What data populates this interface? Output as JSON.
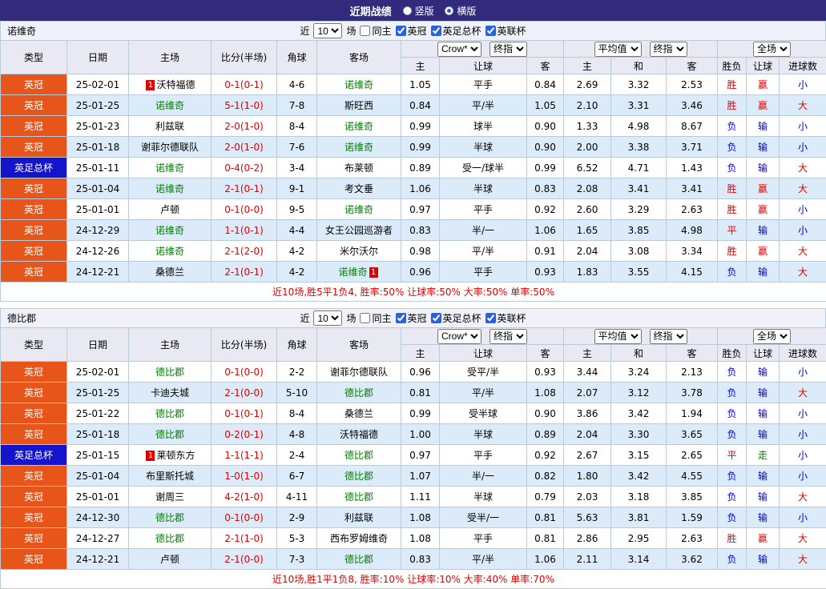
{
  "topbar": {
    "title": "近期战绩",
    "radios": [
      {
        "label": "竖版",
        "selected": false
      },
      {
        "label": "横版",
        "selected": true
      }
    ]
  },
  "colors": {
    "topbar_bg": "#322b7d",
    "league_bg": "#e8551a",
    "cup_bg": "#1414cc",
    "row_alt_bg": "#dcebf9",
    "grid_line": "#b9cadd",
    "header_bg": "#e9e9f3",
    "win_red": "#e00000",
    "lose_blue": "#0000d0",
    "team_green": "#008000"
  },
  "table_header": {
    "cols": [
      "类型",
      "日期",
      "主场",
      "比分(半场)",
      "角球",
      "客场"
    ],
    "bookmaker_select": "Crow*",
    "stage_select_1": "终指",
    "average_select": "平均值",
    "stage_select_2": "终指",
    "scope_select": "全场",
    "sub_cols": [
      "主",
      "让球",
      "客",
      "主",
      "和",
      "客",
      "胜负",
      "让球",
      "进球数"
    ]
  },
  "sections": [
    {
      "team": "诺维奇",
      "controls": {
        "near_label": "近",
        "games_count": "10",
        "games_suffix": "场",
        "same_home": {
          "label": "同主",
          "checked": false
        },
        "league_filters": [
          {
            "label": "英冠",
            "checked": true
          },
          {
            "label": "英足总杯",
            "checked": true
          },
          {
            "label": "英联杯",
            "checked": true
          }
        ]
      },
      "rows": [
        {
          "league": "英冠",
          "league_style": "league",
          "date": "25-02-01",
          "home": {
            "name": "沃特福德",
            "self": false,
            "red_card": "1",
            "card_pos": "left"
          },
          "score": "0-1(0-1)",
          "corners": "4-6",
          "away": {
            "name": "诺维奇",
            "self": true
          },
          "odds": {
            "home": "1.05",
            "handicap": "平手",
            "away": "0.84"
          },
          "avg": {
            "home": "2.69",
            "draw": "3.32",
            "away": "2.53"
          },
          "result": {
            "outcome": "胜",
            "outcome_color": "red",
            "handicap": "赢",
            "handicap_color": "red",
            "goals": "小",
            "goals_color": "blue"
          }
        },
        {
          "league": "英冠",
          "league_style": "league",
          "date": "25-01-25",
          "home": {
            "name": "诺维奇",
            "self": true
          },
          "score": "5-1(1-0)",
          "corners": "7-8",
          "away": {
            "name": "斯旺西",
            "self": false
          },
          "odds": {
            "home": "0.84",
            "handicap": "平/半",
            "away": "1.05"
          },
          "avg": {
            "home": "2.10",
            "draw": "3.31",
            "away": "3.46"
          },
          "result": {
            "outcome": "胜",
            "outcome_color": "red",
            "handicap": "赢",
            "handicap_color": "red",
            "goals": "大",
            "goals_color": "red"
          }
        },
        {
          "league": "英冠",
          "league_style": "league",
          "date": "25-01-23",
          "home": {
            "name": "利兹联",
            "self": false
          },
          "score": "2-0(1-0)",
          "corners": "8-4",
          "away": {
            "name": "诺维奇",
            "self": true
          },
          "odds": {
            "home": "0.99",
            "handicap": "球半",
            "away": "0.90"
          },
          "avg": {
            "home": "1.33",
            "draw": "4.98",
            "away": "8.67"
          },
          "result": {
            "outcome": "负",
            "outcome_color": "blue",
            "handicap": "输",
            "handicap_color": "blue",
            "goals": "小",
            "goals_color": "blue"
          }
        },
        {
          "league": "英冠",
          "league_style": "league",
          "date": "25-01-18",
          "home": {
            "name": "谢菲尔德联队",
            "self": false
          },
          "score": "2-0(1-0)",
          "corners": "7-6",
          "away": {
            "name": "诺维奇",
            "self": true
          },
          "odds": {
            "home": "0.99",
            "handicap": "半球",
            "away": "0.90"
          },
          "avg": {
            "home": "2.00",
            "draw": "3.38",
            "away": "3.71"
          },
          "result": {
            "outcome": "负",
            "outcome_color": "blue",
            "handicap": "输",
            "handicap_color": "blue",
            "goals": "小",
            "goals_color": "blue"
          }
        },
        {
          "league": "英足总杯",
          "league_style": "cup",
          "date": "25-01-11",
          "home": {
            "name": "诺维奇",
            "self": true
          },
          "score": "0-4(0-2)",
          "corners": "3-4",
          "away": {
            "name": "布莱顿",
            "self": false
          },
          "odds": {
            "home": "0.89",
            "handicap": "受一/球半",
            "away": "0.99"
          },
          "avg": {
            "home": "6.52",
            "draw": "4.71",
            "away": "1.43"
          },
          "result": {
            "outcome": "负",
            "outcome_color": "blue",
            "handicap": "输",
            "handicap_color": "blue",
            "goals": "大",
            "goals_color": "red"
          }
        },
        {
          "league": "英冠",
          "league_style": "league",
          "date": "25-01-04",
          "home": {
            "name": "诺维奇",
            "self": true
          },
          "score": "2-1(0-1)",
          "corners": "9-1",
          "away": {
            "name": "考文垂",
            "self": false
          },
          "odds": {
            "home": "1.06",
            "handicap": "半球",
            "away": "0.83"
          },
          "avg": {
            "home": "2.08",
            "draw": "3.41",
            "away": "3.41"
          },
          "result": {
            "outcome": "胜",
            "outcome_color": "red",
            "handicap": "赢",
            "handicap_color": "red",
            "goals": "大",
            "goals_color": "red"
          }
        },
        {
          "league": "英冠",
          "league_style": "league",
          "date": "25-01-01",
          "home": {
            "name": "卢顿",
            "self": false
          },
          "score": "0-1(0-0)",
          "corners": "9-5",
          "away": {
            "name": "诺维奇",
            "self": true
          },
          "odds": {
            "home": "0.97",
            "handicap": "平手",
            "away": "0.92"
          },
          "avg": {
            "home": "2.60",
            "draw": "3.29",
            "away": "2.63"
          },
          "result": {
            "outcome": "胜",
            "outcome_color": "red",
            "handicap": "赢",
            "handicap_color": "red",
            "goals": "小",
            "goals_color": "blue"
          }
        },
        {
          "league": "英冠",
          "league_style": "league",
          "date": "24-12-29",
          "home": {
            "name": "诺维奇",
            "self": true
          },
          "score": "1-1(0-1)",
          "corners": "4-4",
          "away": {
            "name": "女王公园巡游者",
            "self": false
          },
          "odds": {
            "home": "0.83",
            "handicap": "半/一",
            "away": "1.06"
          },
          "avg": {
            "home": "1.65",
            "draw": "3.85",
            "away": "4.98"
          },
          "result": {
            "outcome": "平",
            "outcome_color": "red",
            "handicap": "输",
            "handicap_color": "blue",
            "goals": "小",
            "goals_color": "blue"
          }
        },
        {
          "league": "英冠",
          "league_style": "league",
          "date": "24-12-26",
          "home": {
            "name": "诺维奇",
            "self": true
          },
          "score": "2-1(2-0)",
          "corners": "4-2",
          "away": {
            "name": "米尔沃尔",
            "self": false
          },
          "odds": {
            "home": "0.98",
            "handicap": "平/半",
            "away": "0.91"
          },
          "avg": {
            "home": "2.04",
            "draw": "3.08",
            "away": "3.34"
          },
          "result": {
            "outcome": "胜",
            "outcome_color": "red",
            "handicap": "赢",
            "handicap_color": "red",
            "goals": "大",
            "goals_color": "red"
          }
        },
        {
          "league": "英冠",
          "league_style": "league",
          "date": "24-12-21",
          "home": {
            "name": "桑德兰",
            "self": false
          },
          "score": "2-1(0-1)",
          "corners": "4-2",
          "away": {
            "name": "诺维奇",
            "self": true,
            "red_card": "1",
            "card_pos": "right"
          },
          "odds": {
            "home": "0.96",
            "handicap": "平手",
            "away": "0.93"
          },
          "avg": {
            "home": "1.83",
            "draw": "3.55",
            "away": "4.15"
          },
          "result": {
            "outcome": "负",
            "outcome_color": "blue",
            "handicap": "输",
            "handicap_color": "blue",
            "goals": "大",
            "goals_color": "red"
          }
        }
      ],
      "summary": "近10场,胜5平1负4, 胜率:50% 让球率:50% 大率:50% 单率:50%"
    },
    {
      "team": "德比郡",
      "controls": {
        "near_label": "近",
        "games_count": "10",
        "games_suffix": "场",
        "same_home": {
          "label": "同主",
          "checked": false
        },
        "league_filters": [
          {
            "label": "英冠",
            "checked": true
          },
          {
            "label": "英足总杯",
            "checked": true
          },
          {
            "label": "英联杯",
            "checked": true
          }
        ]
      },
      "rows": [
        {
          "league": "英冠",
          "league_style": "league",
          "date": "25-02-01",
          "home": {
            "name": "德比郡",
            "self": true
          },
          "score": "0-1(0-0)",
          "corners": "2-2",
          "away": {
            "name": "谢菲尔德联队",
            "self": false
          },
          "odds": {
            "home": "0.96",
            "handicap": "受平/半",
            "away": "0.93"
          },
          "avg": {
            "home": "3.44",
            "draw": "3.24",
            "away": "2.13"
          },
          "result": {
            "outcome": "负",
            "outcome_color": "blue",
            "handicap": "输",
            "handicap_color": "blue",
            "goals": "小",
            "goals_color": "blue"
          }
        },
        {
          "league": "英冠",
          "league_style": "league",
          "date": "25-01-25",
          "home": {
            "name": "卡迪夫城",
            "self": false
          },
          "score": "2-1(0-0)",
          "corners": "5-10",
          "away": {
            "name": "德比郡",
            "self": true
          },
          "odds": {
            "home": "0.81",
            "handicap": "平/半",
            "away": "1.08"
          },
          "avg": {
            "home": "2.07",
            "draw": "3.12",
            "away": "3.78"
          },
          "result": {
            "outcome": "负",
            "outcome_color": "blue",
            "handicap": "输",
            "handicap_color": "blue",
            "goals": "大",
            "goals_color": "red"
          }
        },
        {
          "league": "英冠",
          "league_style": "league",
          "date": "25-01-22",
          "home": {
            "name": "德比郡",
            "self": true
          },
          "score": "0-1(0-1)",
          "corners": "8-4",
          "away": {
            "name": "桑德兰",
            "self": false
          },
          "odds": {
            "home": "0.99",
            "handicap": "受半球",
            "away": "0.90"
          },
          "avg": {
            "home": "3.86",
            "draw": "3.42",
            "away": "1.94"
          },
          "result": {
            "outcome": "负",
            "outcome_color": "blue",
            "handicap": "输",
            "handicap_color": "blue",
            "goals": "小",
            "goals_color": "blue"
          }
        },
        {
          "league": "英冠",
          "league_style": "league",
          "date": "25-01-18",
          "home": {
            "name": "德比郡",
            "self": true
          },
          "score": "0-2(0-1)",
          "corners": "4-8",
          "away": {
            "name": "沃特福德",
            "self": false
          },
          "odds": {
            "home": "1.00",
            "handicap": "半球",
            "away": "0.89"
          },
          "avg": {
            "home": "2.04",
            "draw": "3.30",
            "away": "3.65"
          },
          "result": {
            "outcome": "负",
            "outcome_color": "blue",
            "handicap": "输",
            "handicap_color": "blue",
            "goals": "小",
            "goals_color": "blue"
          }
        },
        {
          "league": "英足总杯",
          "league_style": "cup",
          "date": "25-01-15",
          "home": {
            "name": "莱顿东方",
            "self": false,
            "red_card": "1",
            "card_pos": "left"
          },
          "score": "1-1(1-1)",
          "corners": "2-4",
          "away": {
            "name": "德比郡",
            "self": true
          },
          "odds": {
            "home": "0.97",
            "handicap": "平手",
            "away": "0.92"
          },
          "avg": {
            "home": "2.67",
            "draw": "3.15",
            "away": "2.65"
          },
          "result": {
            "outcome": "平",
            "outcome_color": "red",
            "handicap": "走",
            "handicap_color": "green",
            "goals": "小",
            "goals_color": "blue"
          }
        },
        {
          "league": "英冠",
          "league_style": "league",
          "date": "25-01-04",
          "home": {
            "name": "布里斯托城",
            "self": false
          },
          "score": "1-0(1-0)",
          "corners": "6-7",
          "away": {
            "name": "德比郡",
            "self": true
          },
          "odds": {
            "home": "1.07",
            "handicap": "半/一",
            "away": "0.82"
          },
          "avg": {
            "home": "1.80",
            "draw": "3.42",
            "away": "4.55"
          },
          "result": {
            "outcome": "负",
            "outcome_color": "blue",
            "handicap": "输",
            "handicap_color": "blue",
            "goals": "小",
            "goals_color": "blue"
          }
        },
        {
          "league": "英冠",
          "league_style": "league",
          "date": "25-01-01",
          "home": {
            "name": "谢周三",
            "self": false
          },
          "score": "4-2(1-0)",
          "corners": "4-11",
          "away": {
            "name": "德比郡",
            "self": true
          },
          "odds": {
            "home": "1.11",
            "handicap": "半球",
            "away": "0.79"
          },
          "avg": {
            "home": "2.03",
            "draw": "3.18",
            "away": "3.85"
          },
          "result": {
            "outcome": "负",
            "outcome_color": "blue",
            "handicap": "输",
            "handicap_color": "blue",
            "goals": "大",
            "goals_color": "red"
          }
        },
        {
          "league": "英冠",
          "league_style": "league",
          "date": "24-12-30",
          "home": {
            "name": "德比郡",
            "self": true
          },
          "score": "0-1(0-0)",
          "corners": "2-9",
          "away": {
            "name": "利兹联",
            "self": false
          },
          "odds": {
            "home": "1.08",
            "handicap": "受半/一",
            "away": "0.81"
          },
          "avg": {
            "home": "5.63",
            "draw": "3.81",
            "away": "1.59"
          },
          "result": {
            "outcome": "负",
            "outcome_color": "blue",
            "handicap": "输",
            "handicap_color": "blue",
            "goals": "小",
            "goals_color": "blue"
          }
        },
        {
          "league": "英冠",
          "league_style": "league",
          "date": "24-12-27",
          "home": {
            "name": "德比郡",
            "self": true
          },
          "score": "2-1(1-0)",
          "corners": "5-3",
          "away": {
            "name": "西布罗姆维奇",
            "self": false
          },
          "odds": {
            "home": "1.08",
            "handicap": "平手",
            "away": "0.81"
          },
          "avg": {
            "home": "2.86",
            "draw": "2.95",
            "away": "2.63"
          },
          "result": {
            "outcome": "胜",
            "outcome_color": "red",
            "handicap": "赢",
            "handicap_color": "red",
            "goals": "大",
            "goals_color": "red"
          }
        },
        {
          "league": "英冠",
          "league_style": "league",
          "date": "24-12-21",
          "home": {
            "name": "卢顿",
            "self": false
          },
          "score": "2-1(0-0)",
          "corners": "7-3",
          "away": {
            "name": "德比郡",
            "self": true
          },
          "odds": {
            "home": "0.83",
            "handicap": "平/半",
            "away": "1.06"
          },
          "avg": {
            "home": "2.11",
            "draw": "3.14",
            "away": "3.62"
          },
          "result": {
            "outcome": "负",
            "outcome_color": "blue",
            "handicap": "输",
            "handicap_color": "blue",
            "goals": "大",
            "goals_color": "red"
          }
        }
      ],
      "summary": "近10场,胜1平1负8, 胜率:10% 让球率:10% 大率:40% 单率:70%"
    }
  ]
}
